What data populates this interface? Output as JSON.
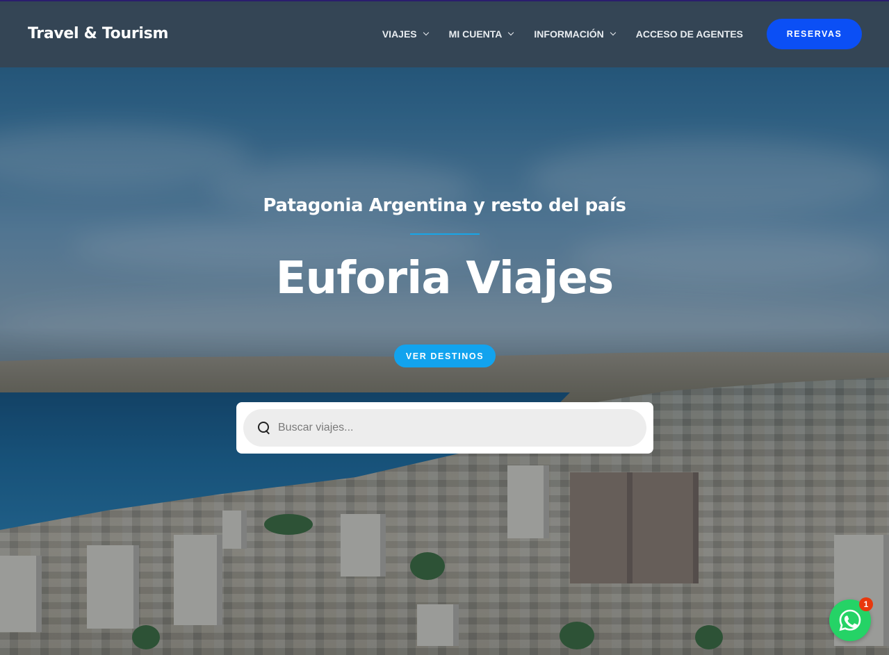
{
  "header": {
    "logo": "Travel & Tourism",
    "nav": [
      {
        "label": "VIAJES",
        "has_dropdown": true
      },
      {
        "label": "MI CUENTA",
        "has_dropdown": true
      },
      {
        "label": "INFORMACIÓN",
        "has_dropdown": true
      },
      {
        "label": "ACCESO DE AGENTES",
        "has_dropdown": false
      }
    ],
    "cta_label": "RESERVAS"
  },
  "hero": {
    "subtitle": "Patagonia Argentina y resto del país",
    "title": "Euforia Viajes",
    "button_label": "VER DESTINOS",
    "search": {
      "placeholder": "Buscar viajes...",
      "value": "",
      "icon": "search-icon"
    }
  },
  "chat_widget": {
    "icon": "whatsapp-icon",
    "badge_count": "1"
  },
  "colors": {
    "header_bg": "#364452",
    "cta_blue": "#0b4ff5",
    "accent_cyan": "#12a3ee",
    "divider": "#17a6e8",
    "whatsapp_green": "#25d366",
    "badge_red": "#e8380d"
  }
}
